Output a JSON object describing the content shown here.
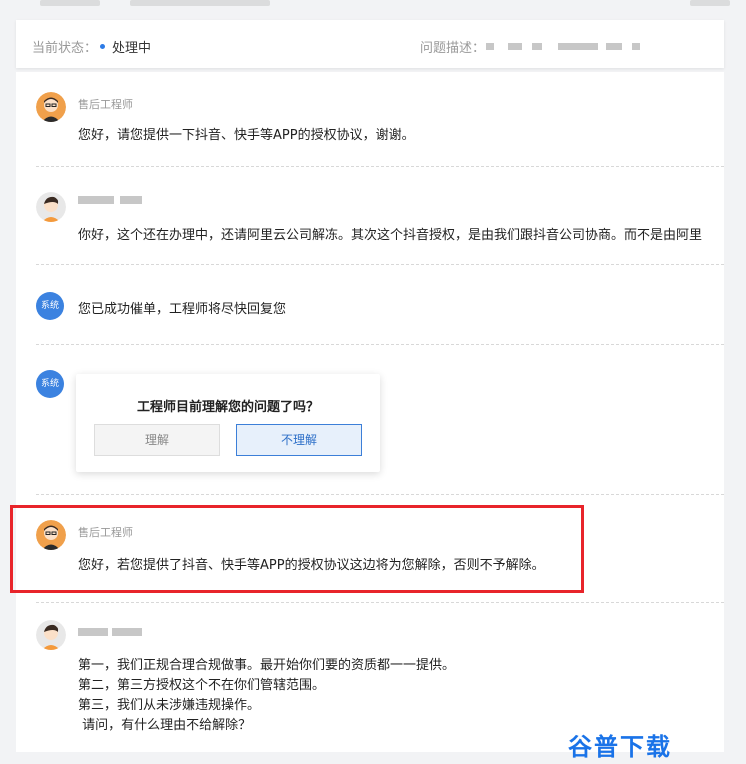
{
  "status_bar": {
    "status_label": "当前状态：",
    "status_value": "处理中",
    "desc_label": "问题描述：",
    "accent_color": "#2d7be6"
  },
  "messages": [
    {
      "sender": "售后工程师",
      "avatar": "engineer-avatar-icon",
      "text": "您好，请您提供一下抖音、快手等APP的授权协议，谢谢。"
    },
    {
      "sender": "",
      "avatar": "user-avatar-icon",
      "text": "你好，这个还在办理中，还请阿里云公司解冻。其次这个抖音授权，是由我们跟抖音公司协商。而不是由阿里"
    },
    {
      "sender": "系统",
      "avatar": "system-badge",
      "text": "您已成功催单，工程师将尽快回复您"
    },
    {
      "sender": "系统",
      "avatar": "system-badge",
      "text": ""
    },
    {
      "sender": "售后工程师",
      "avatar": "engineer-avatar-icon",
      "text": "您好，若您提供了抖音、快手等APP的授权协议这边将为您解除，否则不予解除。"
    },
    {
      "sender": "",
      "avatar": "user-avatar-icon",
      "lines": [
        "第一，我们正规合理合规做事。最开始你们要的资质都一一提供。",
        "第二，第三方授权这个不在你们管辖范围。",
        "第三，我们从未涉嫌违规操作。",
        " 请问，有什么理由不给解除？"
      ]
    }
  ],
  "feedback_popup": {
    "question": "工程师目前理解您的问题了吗？",
    "understand_label": "理解",
    "not_understand_label": "不理解"
  },
  "highlight_color": "#e8242a",
  "watermark": "谷普下载"
}
